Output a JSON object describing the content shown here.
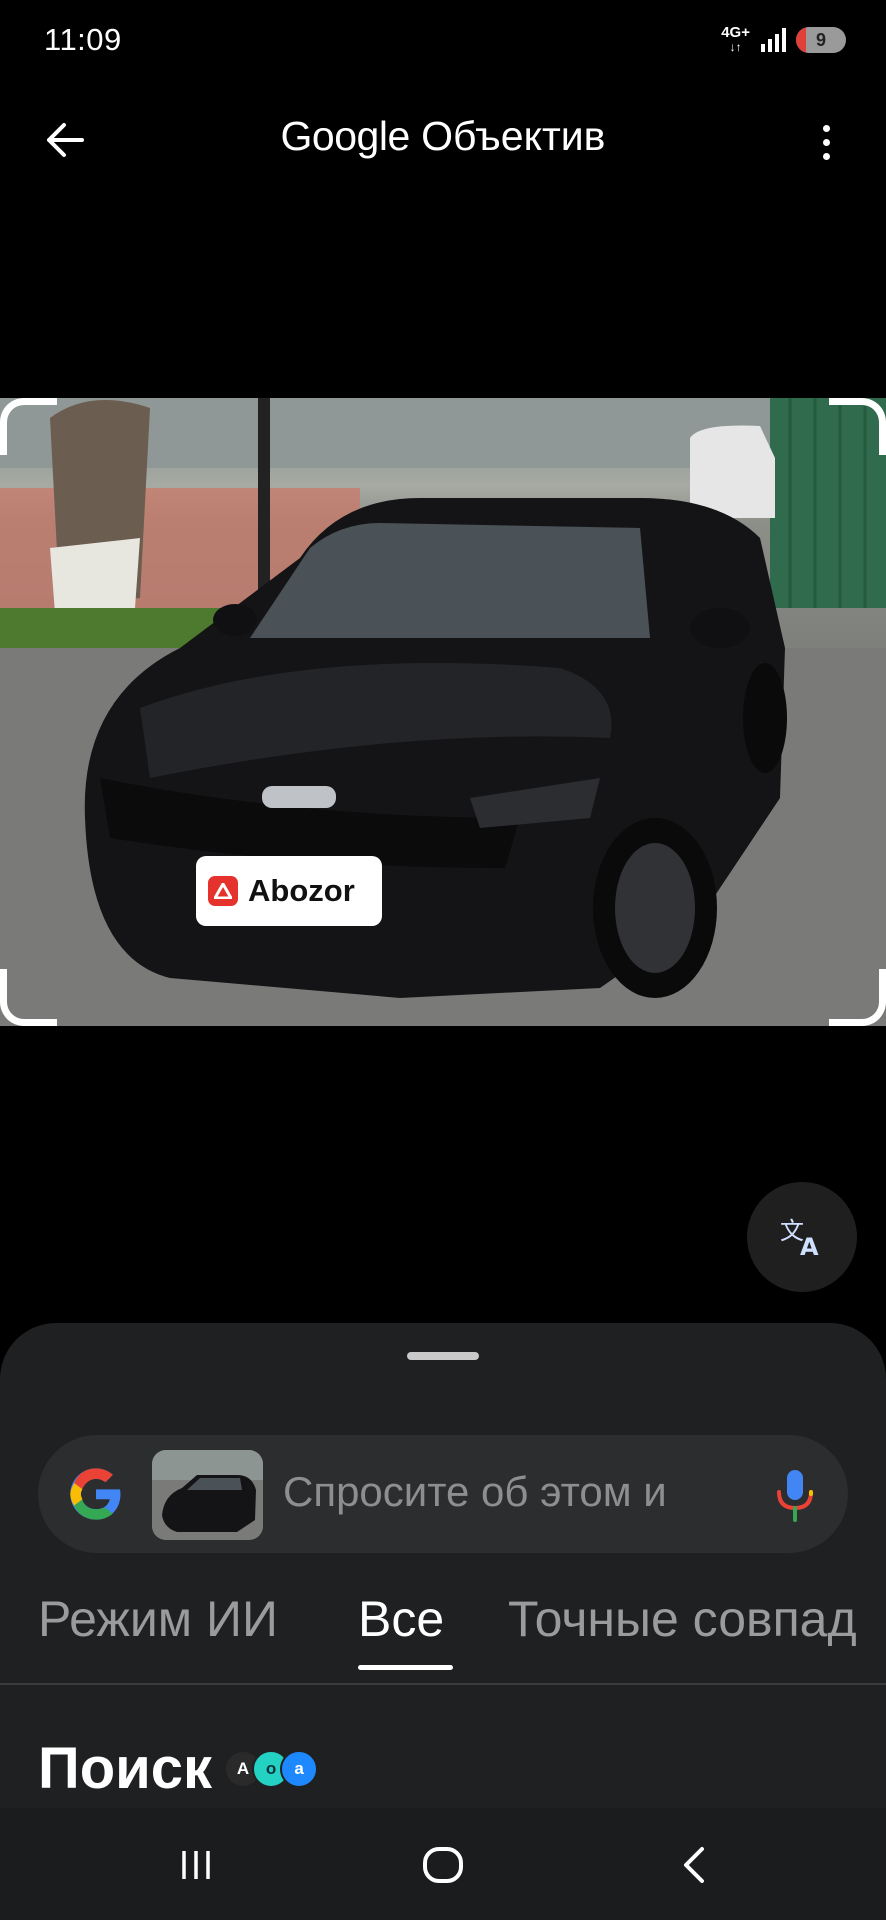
{
  "status_bar": {
    "time": "11:09",
    "network": "4G+",
    "battery": "9"
  },
  "app_bar": {
    "title_brand": "Google",
    "title_product": "Объектив"
  },
  "photo": {
    "watermark": "Abozor"
  },
  "search": {
    "placeholder": "Спросите об этом и"
  },
  "tabs": [
    {
      "label": "Режим ИИ",
      "active": false
    },
    {
      "label": "Все",
      "active": true
    },
    {
      "label": "Точные совпад",
      "active": false
    }
  ],
  "results": {
    "title": "Поиск"
  },
  "colors": {
    "background": "#000000",
    "sheet": "#1f2021",
    "search_bar": "#2c2d2f",
    "accent_red": "#e5322d"
  },
  "icons": [
    "back-arrow-icon",
    "more-vert-icon",
    "translate-icon",
    "google-g-icon",
    "mic-icon",
    "recents-icon",
    "home-icon",
    "back-nav-icon"
  ]
}
